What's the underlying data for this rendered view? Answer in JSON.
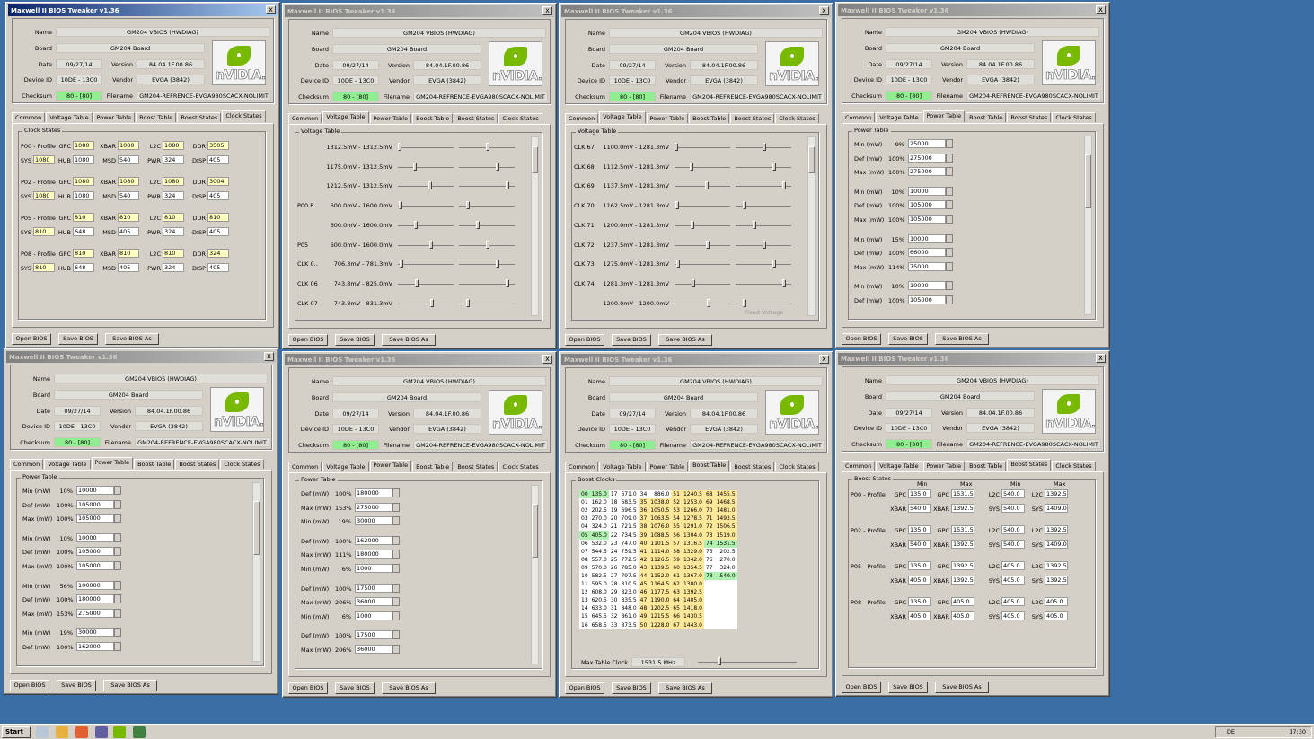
{
  "window": {
    "title": "Maxwell II BIOS Tweaker v1.36",
    "close": "x"
  },
  "info": {
    "name_label": "Name",
    "name": "GM204 VBIOS (HWDIAG)",
    "board_label": "Board",
    "board": "GM204 Board",
    "date_label": "Date",
    "date": "09/27/14",
    "version_label": "Version",
    "version": "84.04.1F.00.86",
    "device_label": "Device ID",
    "device": "10DE - 13C0",
    "vendor_label": "Vendor",
    "vendor": "EVGA (3842)",
    "checksum_label": "Checksum",
    "checksum": "80 - [80]",
    "filename_label": "Filename",
    "filename": "GM204-REFRENCE-EVGA980SCACX-NOLIMIT",
    "logo_text": "nVIDIA."
  },
  "tabs": [
    "Common",
    "Voltage Table",
    "Power Table",
    "Boost Table",
    "Boost States",
    "Clock States"
  ],
  "buttons": {
    "open": "Open BIOS",
    "save": "Save BIOS",
    "save_as": "Save BIOS As"
  },
  "clock_states": {
    "title": "Clock States",
    "labels": {
      "gpc": "GPC",
      "xbar": "XBAR",
      "l2c": "L2C",
      "ddr": "DDR",
      "sys": "SYS",
      "hub": "HUB",
      "msd": "MSD",
      "pwr": "PWR",
      "disp": "DISP"
    },
    "rows": [
      {
        "name": "P00 - Profile",
        "gpc": "1080",
        "xbar": "1080",
        "l2c": "1080",
        "ddr": "3505",
        "sys": "1080",
        "hub": "1080",
        "msd": "540",
        "pwr": "324",
        "disp": "405"
      },
      {
        "name": "P02 - Profile",
        "gpc": "1080",
        "xbar": "1080",
        "l2c": "1080",
        "ddr": "3004",
        "sys": "1080",
        "hub": "1080",
        "msd": "540",
        "pwr": "324",
        "disp": "405"
      },
      {
        "name": "P05 - Profile",
        "gpc": "810",
        "xbar": "810",
        "l2c": "810",
        "ddr": "810",
        "sys": "810",
        "hub": "648",
        "msd": "405",
        "pwr": "324",
        "disp": "405"
      },
      {
        "name": "P08 - Profile",
        "gpc": "810",
        "xbar": "810",
        "l2c": "810",
        "ddr": "324",
        "sys": "810",
        "hub": "648",
        "msd": "405",
        "pwr": "324",
        "disp": "405"
      }
    ]
  },
  "voltage_table_a": {
    "title": "Voltage Table",
    "rows": [
      {
        "label": "",
        "range": "1312.5mV - 1312.5mV"
      },
      {
        "label": "",
        "range": "1175.0mV - 1312.5mV"
      },
      {
        "label": "",
        "range": "1212.5mV - 1312.5mV"
      },
      {
        "label": "P00.P..",
        "range": "600.0mV - 1600.0mV"
      },
      {
        "label": "",
        "range": "600.0mV - 1600.0mV"
      },
      {
        "label": "P05",
        "range": "600.0mV - 1600.0mV"
      },
      {
        "label": "CLK 0..",
        "range": "706.3mV - 781.3mV"
      },
      {
        "label": "CLK 06",
        "range": "743.8mV - 825.0mV"
      },
      {
        "label": "CLK 07",
        "range": "743.8mV - 831.3mV"
      }
    ]
  },
  "voltage_table_b": {
    "title": "Voltage Table",
    "fixed": "Fixed Voltage",
    "rows": [
      {
        "label": "CLK 67",
        "range": "1100.0mV - 1281.3mV"
      },
      {
        "label": "CLK 68",
        "range": "1112.5mV - 1281.3mV"
      },
      {
        "label": "CLK 69",
        "range": "1137.5mV - 1281.3mV"
      },
      {
        "label": "CLK 70",
        "range": "1162.5mV - 1281.3mV"
      },
      {
        "label": "CLK 71",
        "range": "1200.0mV - 1281.3mV"
      },
      {
        "label": "CLK 72",
        "range": "1237.5mV - 1281.3mV"
      },
      {
        "label": "CLK 73",
        "range": "1275.0mV - 1281.3mV"
      },
      {
        "label": "CLK 74",
        "range": "1281.3mV - 1281.3mV"
      },
      {
        "label": "",
        "range": "1200.0mV - 1200.0mV"
      }
    ]
  },
  "power_a": {
    "title": "Power Table",
    "rows": [
      {
        "l": "Min (mW)",
        "p": "9%",
        "v": "25000"
      },
      {
        "l": "Def (mW)",
        "p": "100%",
        "v": "275000"
      },
      {
        "l": "Max (mW)",
        "p": "100%",
        "v": "275000"
      },
      {
        "l": "Min (mW)",
        "p": "10%",
        "v": "10000"
      },
      {
        "l": "Def (mW)",
        "p": "100%",
        "v": "105000"
      },
      {
        "l": "Max (mW)",
        "p": "100%",
        "v": "105000"
      },
      {
        "l": "Min (mW)",
        "p": "15%",
        "v": "10000"
      },
      {
        "l": "Def (mW)",
        "p": "100%",
        "v": "66000"
      },
      {
        "l": "Max (mW)",
        "p": "114%",
        "v": "75000"
      },
      {
        "l": "Min (mW)",
        "p": "10%",
        "v": "10000"
      },
      {
        "l": "Def (mW)",
        "p": "100%",
        "v": "105000"
      }
    ]
  },
  "power_b": {
    "title": "Power Table",
    "rows": [
      {
        "l": "Min (mW)",
        "p": "10%",
        "v": "10000"
      },
      {
        "l": "Def (mW)",
        "p": "100%",
        "v": "105000"
      },
      {
        "l": "Max (mW)",
        "p": "100%",
        "v": "105000"
      },
      {
        "l": "Min (mW)",
        "p": "10%",
        "v": "10000"
      },
      {
        "l": "Def (mW)",
        "p": "100%",
        "v": "105000"
      },
      {
        "l": "Max (mW)",
        "p": "100%",
        "v": "105000"
      },
      {
        "l": "Min (mW)",
        "p": "56%",
        "v": "100000"
      },
      {
        "l": "Def (mW)",
        "p": "100%",
        "v": "180000"
      },
      {
        "l": "Max (mW)",
        "p": "153%",
        "v": "275000"
      },
      {
        "l": "Min (mW)",
        "p": "19%",
        "v": "30000"
      },
      {
        "l": "Def (mW)",
        "p": "100%",
        "v": "162000"
      }
    ]
  },
  "power_c": {
    "title": "Power Table",
    "rows": [
      {
        "l": "Def (mW)",
        "p": "100%",
        "v": "180000"
      },
      {
        "l": "Max (mW)",
        "p": "153%",
        "v": "275000"
      },
      {
        "l": "Min (mW)",
        "p": "19%",
        "v": "30000"
      },
      {
        "l": "Def (mW)",
        "p": "100%",
        "v": "162000"
      },
      {
        "l": "Max (mW)",
        "p": "111%",
        "v": "180000"
      },
      {
        "l": "Min (mW)",
        "p": "6%",
        "v": "1000"
      },
      {
        "l": "Def (mW)",
        "p": "100%",
        "v": "17500"
      },
      {
        "l": "Max (mW)",
        "p": "206%",
        "v": "36000"
      },
      {
        "l": "Min (mW)",
        "p": "6%",
        "v": "1000"
      },
      {
        "l": "Def (mW)",
        "p": "100%",
        "v": "17500"
      },
      {
        "l": "Max (mW)",
        "p": "206%",
        "v": "36000"
      }
    ]
  },
  "boost_clocks": {
    "title": "Boost Clocks",
    "max_label": "Max Table Clock",
    "max_value": "1531.5 MHz",
    "rows": [
      [
        "00",
        "135.0",
        "17",
        "671.0",
        "34",
        "886.0",
        "51",
        "1240.5",
        "68",
        "1455.5"
      ],
      [
        "01",
        "162.0",
        "18",
        "683.5",
        "35",
        "1038.0",
        "52",
        "1253.0",
        "69",
        "1468.5"
      ],
      [
        "02",
        "202.5",
        "19",
        "696.5",
        "36",
        "1050.5",
        "53",
        "1266.0",
        "70",
        "1481.0"
      ],
      [
        "03",
        "270.0",
        "20",
        "709.0",
        "37",
        "1063.5",
        "54",
        "1278.5",
        "71",
        "1493.5"
      ],
      [
        "04",
        "324.0",
        "21",
        "721.5",
        "38",
        "1076.0",
        "55",
        "1291.0",
        "72",
        "1506.5"
      ],
      [
        "05",
        "405.0",
        "22",
        "734.5",
        "39",
        "1088.5",
        "56",
        "1304.0",
        "73",
        "1519.0"
      ],
      [
        "06",
        "532.0",
        "23",
        "747.0",
        "40",
        "1101.5",
        "57",
        "1316.5",
        "74",
        "1531.5"
      ],
      [
        "07",
        "544.5",
        "24",
        "759.5",
        "41",
        "1114.0",
        "58",
        "1329.0",
        "75",
        "202.5"
      ],
      [
        "08",
        "557.0",
        "25",
        "772.5",
        "42",
        "1126.5",
        "59",
        "1342.0",
        "76",
        "270.0"
      ],
      [
        "09",
        "570.0",
        "26",
        "785.0",
        "43",
        "1139.5",
        "60",
        "1354.5",
        "77",
        "324.0"
      ],
      [
        "10",
        "582.5",
        "27",
        "797.5",
        "44",
        "1152.0",
        "61",
        "1367.0",
        "78",
        "540.0"
      ],
      [
        "11",
        "595.0",
        "28",
        "810.5",
        "45",
        "1164.5",
        "62",
        "1380.0",
        "",
        ""
      ],
      [
        "12",
        "608.0",
        "29",
        "823.0",
        "46",
        "1177.5",
        "63",
        "1392.5",
        "",
        ""
      ],
      [
        "13",
        "620.5",
        "30",
        "835.5",
        "47",
        "1190.0",
        "64",
        "1405.0",
        "",
        ""
      ],
      [
        "14",
        "633.0",
        "31",
        "848.0",
        "48",
        "1202.5",
        "65",
        "1418.0",
        "",
        ""
      ],
      [
        "15",
        "645.5",
        "32",
        "861.0",
        "49",
        "1215.5",
        "66",
        "1430.5",
        "",
        ""
      ],
      [
        "16",
        "658.5",
        "33",
        "873.5",
        "50",
        "1228.0",
        "67",
        "1443.0",
        "",
        ""
      ]
    ]
  },
  "boost_states": {
    "title": "Boost States",
    "min": "Min",
    "max": "Max",
    "rows": [
      {
        "name": "P00 - Profile",
        "gpc_min": "135.0",
        "gpc_max": "1531.5",
        "l2c_min": "540.0",
        "l2c_max": "1392.5",
        "xbar_min": "540.0",
        "xbar_max": "1392.5",
        "sys_min": "540.0",
        "sys_max": "1409.0"
      },
      {
        "name": "P02 - Profile",
        "gpc_min": "135.0",
        "gpc_max": "1531.5",
        "l2c_min": "540.0",
        "l2c_max": "1392.5",
        "xbar_min": "540.0",
        "xbar_max": "1392.5",
        "sys_min": "540.0",
        "sys_max": "1409.0"
      },
      {
        "name": "P05 - Profile",
        "gpc_min": "135.0",
        "gpc_max": "1392.5",
        "l2c_min": "405.0",
        "l2c_max": "1392.5",
        "xbar_min": "405.0",
        "xbar_max": "1392.5",
        "sys_min": "405.0",
        "sys_max": "1392.5"
      },
      {
        "name": "P08 - Profile",
        "gpc_min": "135.0",
        "gpc_max": "405.0",
        "l2c_min": "405.0",
        "l2c_max": "405.0",
        "xbar_min": "405.0",
        "xbar_max": "405.0",
        "sys_min": "405.0",
        "sys_max": "405.0"
      }
    ]
  },
  "taskbar": {
    "start": "Start",
    "lang": "DE",
    "time": "17:30"
  }
}
